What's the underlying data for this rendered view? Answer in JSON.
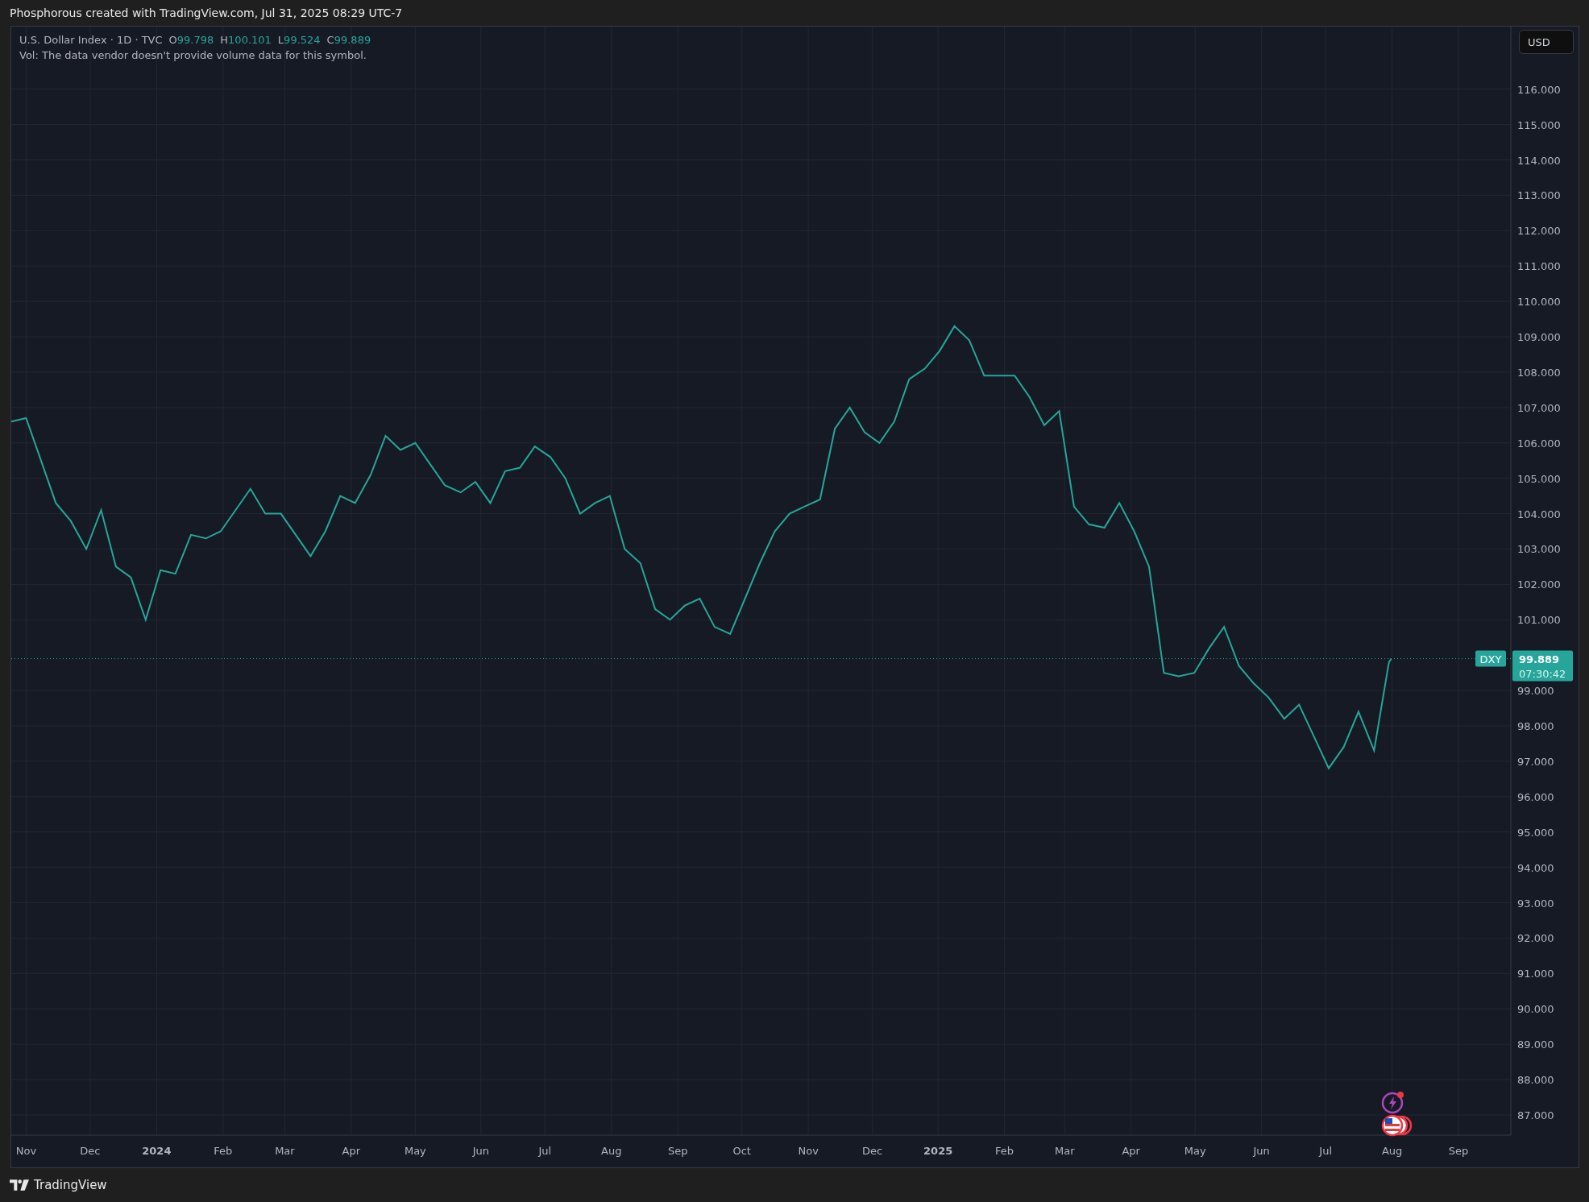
{
  "header": {
    "title": "Phosphorous created with TradingView.com, Jul 31, 2025 08:29 UTC-7"
  },
  "legend": {
    "symbol": "U.S. Dollar Index · 1D · TVC",
    "ohlc": [
      {
        "key": "O",
        "value": "99.798"
      },
      {
        "key": "H",
        "value": "100.101"
      },
      {
        "key": "L",
        "value": "99.524"
      },
      {
        "key": "C",
        "value": "99.889"
      }
    ],
    "volume_note": "Vol: The data vendor doesn't provide volume data for this symbol."
  },
  "currency": "USD",
  "last_price": {
    "price": "99.889",
    "countdown": "07:30:42"
  },
  "chart_data": {
    "type": "line",
    "grid": true,
    "xlim": [
      2023.814,
      2025.733
    ],
    "ylim": [
      86.43,
      117.77
    ],
    "x": [
      2023.814,
      2023.833,
      2023.852,
      2023.871,
      2023.89,
      2023.91,
      2023.929,
      2023.948,
      2023.967,
      2023.986,
      2024.005,
      2024.024,
      2024.044,
      2024.063,
      2024.082,
      2024.101,
      2024.12,
      2024.139,
      2024.159,
      2024.178,
      2024.197,
      2024.216,
      2024.235,
      2024.254,
      2024.274,
      2024.293,
      2024.312,
      2024.331,
      2024.35,
      2024.369,
      2024.389,
      2024.408,
      2024.427,
      2024.446,
      2024.465,
      2024.484,
      2024.504,
      2024.523,
      2024.542,
      2024.561,
      2024.58,
      2024.599,
      2024.619,
      2024.638,
      2024.657,
      2024.676,
      2024.695,
      2024.714,
      2024.734,
      2024.753,
      2024.772,
      2024.791,
      2024.81,
      2024.829,
      2024.849,
      2024.868,
      2024.887,
      2024.906,
      2024.925,
      2024.944,
      2024.963,
      2024.983,
      2025.002,
      2025.021,
      2025.04,
      2025.059,
      2025.078,
      2025.098,
      2025.117,
      2025.136,
      2025.155,
      2025.174,
      2025.193,
      2025.213,
      2025.232,
      2025.251,
      2025.27,
      2025.289,
      2025.308,
      2025.328,
      2025.347,
      2025.366,
      2025.385,
      2025.404,
      2025.423,
      2025.443,
      2025.462,
      2025.481,
      2025.5,
      2025.519,
      2025.538,
      2025.558,
      2025.577,
      2025.58
    ],
    "series": [
      {
        "name": "DXY",
        "color": "#26a69a",
        "values": [
          106.6,
          106.7,
          105.5,
          104.3,
          103.8,
          103.0,
          104.1,
          102.5,
          102.2,
          101.0,
          102.4,
          102.3,
          103.4,
          103.3,
          103.5,
          104.1,
          104.7,
          104.0,
          104.0,
          103.4,
          102.8,
          103.5,
          104.5,
          104.3,
          105.1,
          106.2,
          105.8,
          106.0,
          105.4,
          104.8,
          104.6,
          104.9,
          104.3,
          105.2,
          105.3,
          105.9,
          105.6,
          105.0,
          104.0,
          104.3,
          104.5,
          103.0,
          102.6,
          101.3,
          101.0,
          101.4,
          101.6,
          100.8,
          100.6,
          101.6,
          102.6,
          103.5,
          104.0,
          104.2,
          104.4,
          106.4,
          107.0,
          106.3,
          106.0,
          106.6,
          107.8,
          108.1,
          108.6,
          109.3,
          108.9,
          107.9,
          107.9,
          107.9,
          107.3,
          106.5,
          106.9,
          104.2,
          103.7,
          103.6,
          104.3,
          103.5,
          102.5,
          99.5,
          99.4,
          99.5,
          100.2,
          100.8,
          99.7,
          99.2,
          98.8,
          98.2,
          98.6,
          97.7,
          96.8,
          97.4,
          98.4,
          97.3,
          99.8,
          99.9
        ]
      }
    ],
    "xticks": [
      {
        "value": 2023.833,
        "label": "Nov"
      },
      {
        "value": 2023.915,
        "label": "Dec"
      },
      {
        "value": 2024,
        "label": "**2024**"
      },
      {
        "value": 2024.085,
        "label": "Feb"
      },
      {
        "value": 2024.164,
        "label": "Mar"
      },
      {
        "value": 2024.249,
        "label": "Apr"
      },
      {
        "value": 2024.331,
        "label": "May"
      },
      {
        "value": 2024.415,
        "label": "Jun"
      },
      {
        "value": 2024.497,
        "label": "Jul"
      },
      {
        "value": 2024.582,
        "label": "Aug"
      },
      {
        "value": 2024.667,
        "label": "Sep"
      },
      {
        "value": 2024.749,
        "label": "Oct"
      },
      {
        "value": 2024.834,
        "label": "Nov"
      },
      {
        "value": 2024.916,
        "label": "Dec"
      },
      {
        "value": 2025,
        "label": "**2025**"
      },
      {
        "value": 2025.085,
        "label": "Feb"
      },
      {
        "value": 2025.162,
        "label": "Mar"
      },
      {
        "value": 2025.247,
        "label": "Apr"
      },
      {
        "value": 2025.329,
        "label": "May"
      },
      {
        "value": 2025.414,
        "label": "Jun"
      },
      {
        "value": 2025.496,
        "label": "Jul"
      },
      {
        "value": 2025.581,
        "label": "Aug"
      },
      {
        "value": 2025.666,
        "label": "Sep"
      }
    ],
    "yticks": [
      {
        "value": 87,
        "label": "87.000"
      },
      {
        "value": 88,
        "label": "88.000"
      },
      {
        "value": 89,
        "label": "89.000"
      },
      {
        "value": 90,
        "label": "90.000"
      },
      {
        "value": 91,
        "label": "91.000"
      },
      {
        "value": 92,
        "label": "92.000"
      },
      {
        "value": 93,
        "label": "93.000"
      },
      {
        "value": 94,
        "label": "94.000"
      },
      {
        "value": 95,
        "label": "95.000"
      },
      {
        "value": 96,
        "label": "96.000"
      },
      {
        "value": 97,
        "label": "97.000"
      },
      {
        "value": 98,
        "label": "98.000"
      },
      {
        "value": 99,
        "label": "99.000"
      },
      {
        "value": 101,
        "label": "101.000"
      },
      {
        "value": 102,
        "label": "102.000"
      },
      {
        "value": 103,
        "label": "103.000"
      },
      {
        "value": 104,
        "label": "104.000"
      },
      {
        "value": 105,
        "label": "105.000"
      },
      {
        "value": 106,
        "label": "106.000"
      },
      {
        "value": 107,
        "label": "107.000"
      },
      {
        "value": 108,
        "label": "108.000"
      },
      {
        "value": 109,
        "label": "109.000"
      },
      {
        "value": 110,
        "label": "110.000"
      },
      {
        "value": 111,
        "label": "111.000"
      },
      {
        "value": 112,
        "label": "112.000"
      },
      {
        "value": 113,
        "label": "113.000"
      },
      {
        "value": 114,
        "label": "114.000"
      },
      {
        "value": 115,
        "label": "115.000"
      },
      {
        "value": 116,
        "label": "116.000"
      }
    ]
  },
  "footer": {
    "brand": "TradingView"
  }
}
